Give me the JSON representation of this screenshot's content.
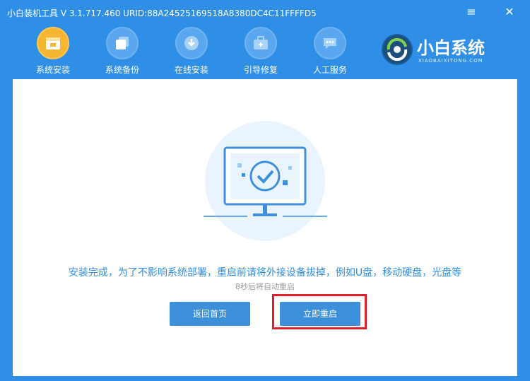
{
  "title": "小白装机工具 V 3.1.717.460 URID:88A24525169518A8380DC4C11FFFFD5",
  "window_controls": {
    "menu": "≡",
    "close": "✕"
  },
  "nav": [
    {
      "label": "系统安装",
      "icon": "install-icon",
      "active": true
    },
    {
      "label": "系统备份",
      "icon": "backup-icon",
      "active": false
    },
    {
      "label": "在线安装",
      "icon": "download-icon",
      "active": false
    },
    {
      "label": "引导修复",
      "icon": "toolbox-icon",
      "active": false
    },
    {
      "label": "人工服务",
      "icon": "chat-icon",
      "active": false
    }
  ],
  "brand": {
    "name": "小白系统",
    "sub": "XIAOBAIXITONG.COM"
  },
  "content": {
    "message": "安装完成，为了不影响系统部署，重启前请将外接设备拔掉，例如U盘，移动硬盘，光盘等",
    "countdown": "8秒后将自动重启",
    "home_button": "返回首页",
    "restart_button": "立即重启"
  },
  "colors": {
    "primary": "#2f8fe6",
    "button": "#3c8fd9",
    "highlight": "#e0202a",
    "active_nav": "#f7b632"
  }
}
